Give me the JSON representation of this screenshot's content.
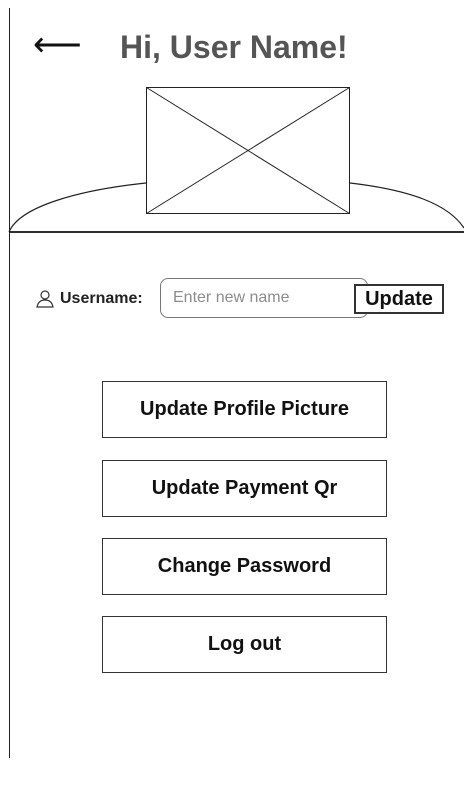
{
  "header": {
    "title": "Hi, User Name!",
    "back_icon": "left-arrow-icon",
    "back_glyph": "⟵"
  },
  "profile": {
    "avatar_icon": "image-placeholder-icon"
  },
  "username": {
    "icon": "user-icon",
    "label": "Username:",
    "placeholder": "Enter new name",
    "value": "",
    "button_label": "Update"
  },
  "actions": [
    {
      "label": "Update Profile Picture"
    },
    {
      "label": "Update Payment Qr"
    },
    {
      "label": "Change Password"
    },
    {
      "label": "Log out"
    }
  ],
  "colors": {
    "title_text": "#555555",
    "border": "#333333",
    "placeholder_text": "#8c8c8c"
  }
}
